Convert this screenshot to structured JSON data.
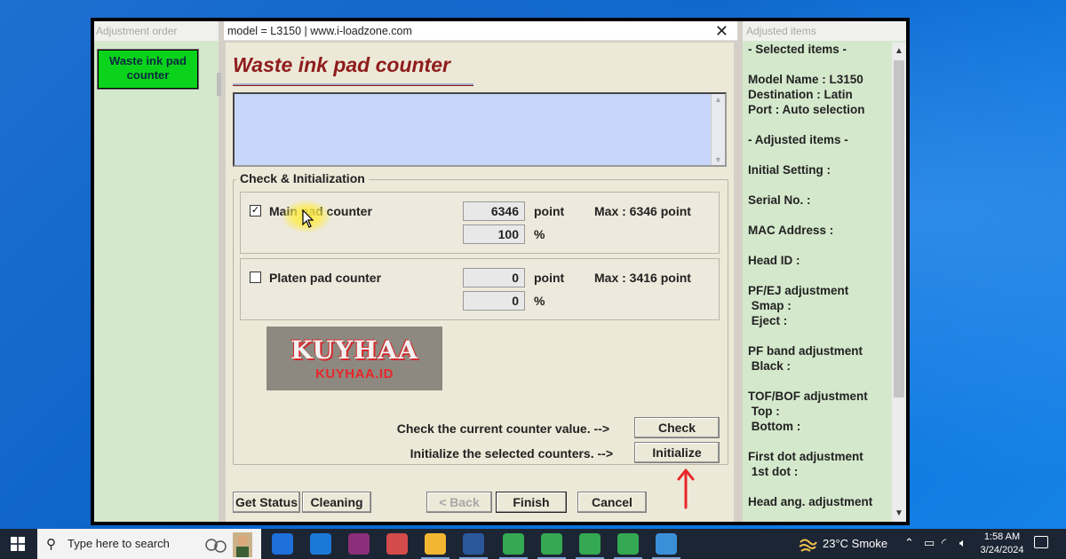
{
  "left_pane": {
    "header": "Adjustment order",
    "selected_item": "Waste ink pad counter"
  },
  "dialog": {
    "titlebar": "model = L3150 | www.i-loadzone.com",
    "close_glyph": "✕",
    "heading": "Waste ink pad counter",
    "group_title": "Check & Initialization",
    "main_pad": {
      "checked": true,
      "check_glyph": "✓",
      "label": "Main pad counter",
      "point_value": "6346",
      "percent_value": "100",
      "unit_point": "point",
      "unit_percent": "%",
      "max": "Max : 6346 point"
    },
    "platen_pad": {
      "checked": false,
      "label": "Platen pad counter",
      "point_value": "0",
      "percent_value": "0",
      "unit_point": "point",
      "unit_percent": "%",
      "max": "Max : 3416 point"
    },
    "hint_check": "Check the current counter value. -->",
    "hint_initialize": "Initialize the selected counters. -->",
    "buttons": {
      "check": "Check",
      "initialize": "Initialize",
      "get_status": "Get Status",
      "cleaning": "Cleaning",
      "back": "< Back",
      "finish": "Finish",
      "cancel": "Cancel"
    }
  },
  "watermark": {
    "big": "KUYHAA",
    "small": "KUYHAA.ID"
  },
  "right_pane": {
    "header": "Adjusted items",
    "lines": [
      "- Selected items -",
      "Model Name : L3150",
      "Destination : Latin",
      "Port : Auto selection",
      "- Adjusted items -",
      "Initial Setting :",
      "Serial No. :",
      "MAC Address :",
      "Head ID :",
      "PF/EJ adjustment",
      " Smap :",
      " Eject :",
      "PF band adjustment",
      " Black :",
      "TOF/BOF adjustment",
      " Top :",
      " Bottom :",
      "First dot adjustment",
      " 1st dot :",
      "Head ang. adjustment"
    ]
  },
  "taskbar": {
    "search_placeholder": "Type here to search",
    "apps": [
      "store-icon",
      "mail-icon",
      "winrar-icon",
      "paint-icon",
      "file-explorer-icon",
      "word-icon",
      "chrome-icon",
      "chrome-profile-a-icon",
      "chrome-profile-b-icon",
      "chrome-profile-k-icon",
      "control-panel-icon"
    ],
    "weather": "23°C  Smoke",
    "time": "1:58 AM",
    "date": "3/24/2024"
  },
  "colors": {
    "selected_item_bg": "#0bd31b",
    "heading": "#8f1c1c",
    "message_box": "#c9d6fb",
    "pane_bg": "#d4e8cc",
    "annotation_arrow": "#e8262a",
    "desktop": "#0a63c9"
  }
}
